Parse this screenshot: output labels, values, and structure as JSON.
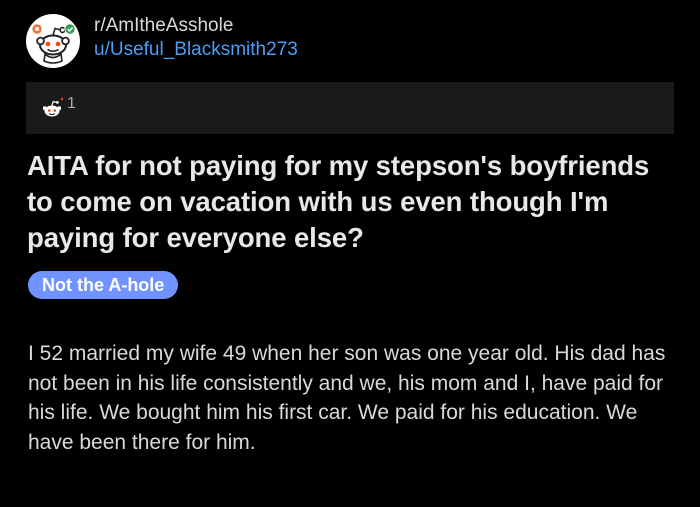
{
  "post": {
    "subreddit": "r/AmItheAsshole",
    "author": "u/Useful_Blacksmith273",
    "award_count": "1",
    "title": "AITA for not paying for my stepson's boyfriends to come on vacation with us even though I'm paying for everyone else?",
    "flair": "Not the A-hole",
    "body": "I 52 married my wife 49 when her son was one year old. His dad has not been in his life consistently and we, his mom and I, have paid for his life.  We bought him his first car. We paid for his education. We have been there for him."
  },
  "icons": {
    "avatar": "reddit-snoo-icon",
    "award": "snoo-award-icon"
  },
  "colors": {
    "background": "#000000",
    "award_bar": "#1a1a1b",
    "username": "#4a9ff5",
    "flair": "#7193ff",
    "title": "#e8e8e8",
    "body": "#d7dadc"
  }
}
